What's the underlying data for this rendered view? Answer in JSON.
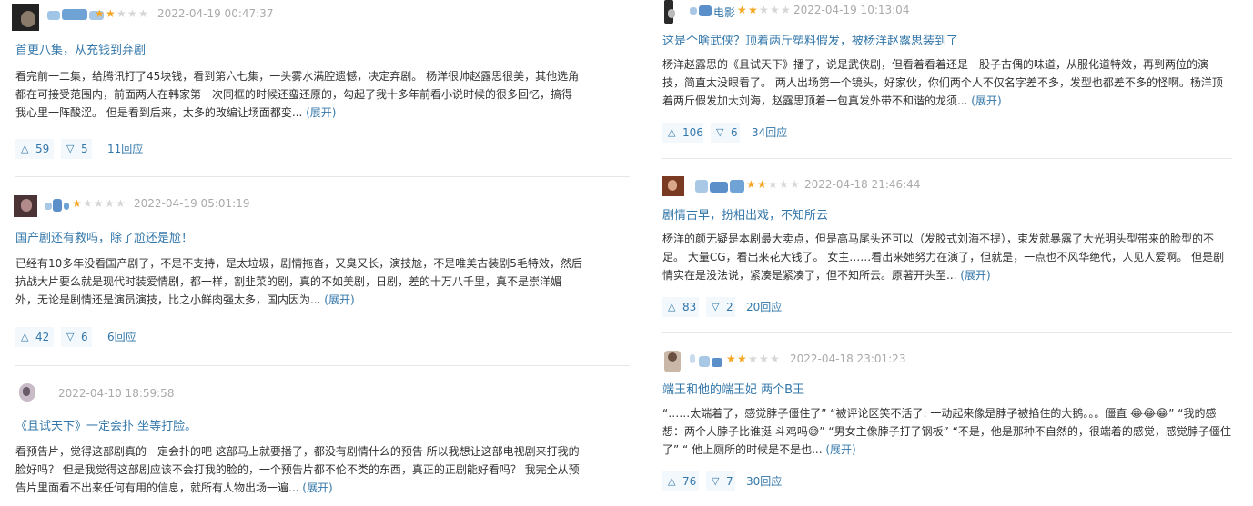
{
  "reviews_left": [
    {
      "username": "",
      "rating": 2,
      "timestamp": "2022-04-19 00:47:37",
      "title": "首更八集，从充钱到弃剧",
      "body_lines": [
        "看完前一二集，给腾讯打了45块钱，看到第六七集，一头雾水满腔遗憾，决定弃剧。 杨洋很帅赵露思很美，其他选角",
        "都在可接受范围内，前面两人在韩家第一次同框的时候还蛮还原的，勾起了我十多年前看小说时候的很多回忆，搞得",
        "我心里一阵酸涩。 但是看到后来，太多的改编让场面都变... "
      ],
      "expand": "(展开)",
      "up": "59",
      "down": "5",
      "replies": "11回应"
    },
    {
      "username": "",
      "rating": 1,
      "timestamp": "2022-04-19 05:01:19",
      "title": "国产剧还有救吗，除了尬还是尬！",
      "body_lines": [
        "已经有10多年没看国产剧了，不是不支持，是太垃圾，剧情拖沓，又臭又长，演技尬，不是唯美古装剧5毛特效，然后",
        "抗战大片要么就是现代时装爱情剧，都一样，割韭菜的剧，真的不如美剧，日剧，差的十万八千里，真不是崇洋媚",
        "外，无论是剧情还是演员演技，比之小鲜肉强太多，国内因为... "
      ],
      "expand": "(展开)",
      "up": "42",
      "down": "6",
      "replies": "6回应"
    },
    {
      "username": "",
      "rating": 0,
      "timestamp": "2022-04-10 18:59:58",
      "title": "《且试天下》一定会扑 坐等打脸。",
      "body_lines": [
        "看预告片，觉得这部剧真的一定会扑的吧 这部马上就要播了，都没有剧情什么的预告 所以我想让这部电视剧来打我的",
        "脸好吗？ 但是我觉得这部剧应该不会打我的脸的，一个预告片都不伦不类的东西，真正的正剧能好看吗？ 我完全从预",
        "告片里面看不出来任何有用的信息，就所有人物出场一遍... "
      ],
      "expand": "(展开)"
    }
  ],
  "reviews_right": [
    {
      "username": "电影",
      "rating": 2,
      "timestamp": "2022-04-19 10:13:04",
      "title": "这是个啥武侠？顶着两斤塑料假发，被杨洋赵露思装到了",
      "body_lines": [
        "杨洋赵露思的《且试天下》播了，说是武侠剧，但看着看着还是一股子古偶的味道，从服化道特效，再到两位的演",
        "技，简直太没眼看了。 两人出场第一个镜头，好家伙，你们两个人不仅名字差不多，发型也都差不多的怪啊。杨洋顶",
        "着两斤假发加大刘海，赵露思顶着一包真发外带不和谐的龙须... "
      ],
      "expand": "(展开)",
      "up": "106",
      "down": "6",
      "replies": "34回应"
    },
    {
      "username": "",
      "rating": 2,
      "timestamp": "2022-04-18 21:46:44",
      "title": "剧情古早，扮相出戏，不知所云",
      "body_lines": [
        "杨洋的颜无疑是本剧最大卖点，但是高马尾头还可以（发胶式刘海不提），束发就暴露了大光明头型带来的脸型的不",
        "足。 大量CG，看出来花大钱了。 女主……看出来她努力在演了，但就是，一点也不风华绝代，人见人爱啊。 但是剧",
        "情实在是没法说，紧凑是紧凑了，但不知所云。原著开头至... "
      ],
      "expand": "(展开)",
      "up": "83",
      "down": "2",
      "replies": "20回应"
    },
    {
      "username": "",
      "rating": 2,
      "timestamp": "2022-04-18 23:01:23",
      "title": "端王和他的端王妃 两个B王",
      "body_lines": [
        "“……太端着了，感觉脖子僵住了” “被评论区笑不活了: 一动起来像是脖子被掐住的大鹅。。。僵直 😂😂😂” “我的感",
        "想：两个人脖子比谁挺 斗鸡吗😅” “男女主像脖子打了钢板” “不是，他是那种不自然的，很端着的感觉，感觉脖子僵住",
        "了” “ 他上厕所的时候是不是也... "
      ],
      "expand": "(展开)",
      "up": "76",
      "down": "7",
      "replies": "30回应"
    }
  ],
  "icons": {
    "star": "star-icon",
    "upvote": "upvote-triangle-icon",
    "downvote": "downvote-triangle-icon"
  },
  "colors": {
    "link": "#3377aa",
    "star_on": "#f5a623",
    "star_off": "#d6d6d6",
    "timestamp": "#aaaaaa",
    "button_bg": "#f2f8fb"
  }
}
